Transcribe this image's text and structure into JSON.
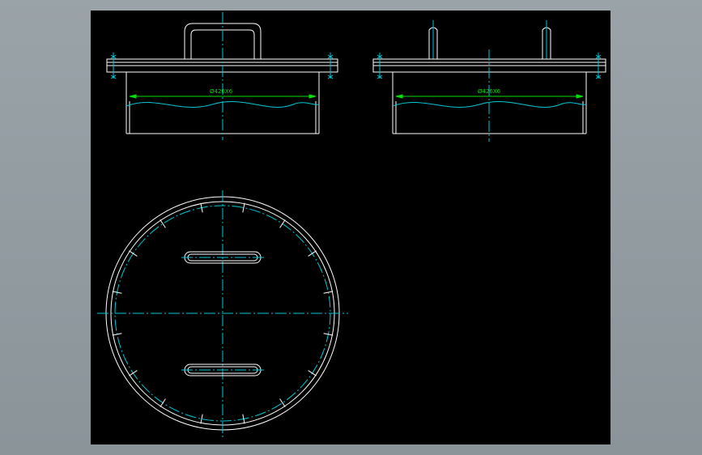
{
  "drawing": {
    "background": "#000000",
    "line_color": "#ffffff",
    "centerline_color": "#00c8d8",
    "dimension_color": "#00e000",
    "left_view": {
      "dimension_text": "Ø426X6"
    },
    "right_view": {
      "dimension_text": "Ø426X6"
    },
    "bolt_hole_count": 16,
    "handle_count": 2
  }
}
